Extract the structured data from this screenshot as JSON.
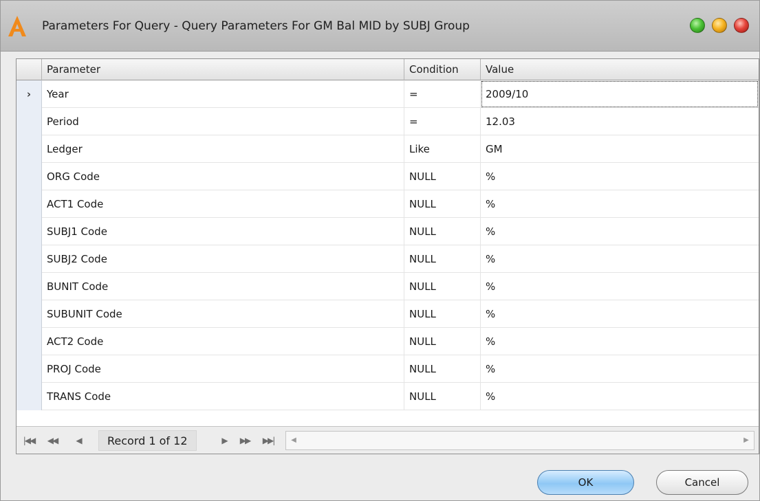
{
  "window": {
    "title": "Parameters For Query - Query Parameters For GM Bal MID by SUBJ Group",
    "icon": "app-logo-a-icon",
    "accent_colors": {
      "close": "#e5453b",
      "minimize": "#f6b422",
      "maximize": "#4cc236"
    }
  },
  "grid": {
    "columns": [
      "Parameter",
      "Condition",
      "Value"
    ],
    "current_row_indicator": "›",
    "rows": [
      {
        "parameter": "Year",
        "condition": "=",
        "value": "2009/10"
      },
      {
        "parameter": "Period",
        "condition": "=",
        "value": " 12.03"
      },
      {
        "parameter": "Ledger",
        "condition": "Like",
        "value": "GM"
      },
      {
        "parameter": "ORG Code",
        "condition": "NULL",
        "value": "%"
      },
      {
        "parameter": "ACT1 Code",
        "condition": "NULL",
        "value": "%"
      },
      {
        "parameter": "SUBJ1 Code",
        "condition": "NULL",
        "value": "%"
      },
      {
        "parameter": "SUBJ2 Code",
        "condition": "NULL",
        "value": "%"
      },
      {
        "parameter": "BUNIT Code",
        "condition": "NULL",
        "value": "%"
      },
      {
        "parameter": "SUBUNIT Code",
        "condition": "NULL",
        "value": "%"
      },
      {
        "parameter": "ACT2 Code",
        "condition": "NULL",
        "value": "%"
      },
      {
        "parameter": "PROJ Code",
        "condition": "NULL",
        "value": "%"
      },
      {
        "parameter": "TRANS Code",
        "condition": "NULL",
        "value": "%"
      }
    ]
  },
  "navigator": {
    "record_text": "Record 1 of 12",
    "first_icon": "skip-first-icon",
    "prev_page_icon": "fast-back-icon",
    "prev_icon": "prev-icon",
    "next_icon": "next-icon",
    "next_page_icon": "fast-forward-icon",
    "last_icon": "skip-last-icon"
  },
  "buttons": {
    "ok": "OK",
    "cancel": "Cancel"
  }
}
